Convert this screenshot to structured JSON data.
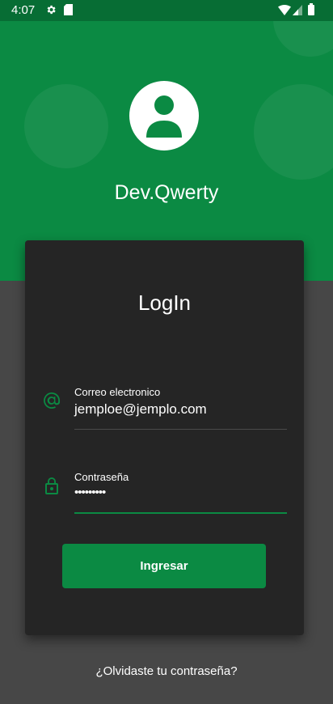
{
  "status_bar": {
    "time": "4:07",
    "icons": [
      "gear-icon",
      "sd-card-icon",
      "wifi-icon",
      "signal-icon",
      "battery-icon"
    ]
  },
  "header": {
    "app_name": "Dev.Qwerty",
    "avatar_icon": "user-avatar-icon"
  },
  "login_card": {
    "title": "LogIn",
    "email": {
      "label": "Correo electronico",
      "value": "jemploe@jemplo.com",
      "icon": "at-sign-icon"
    },
    "password": {
      "label": "Contraseña",
      "value": "•••••••••",
      "icon": "lock-icon"
    },
    "submit_label": "Ingresar"
  },
  "forgot_password": "¿Olvidaste tu contraseña?",
  "colors": {
    "primary": "#0b8a43",
    "status_bar": "#076d34",
    "background": "#474747",
    "card": "#252525"
  }
}
